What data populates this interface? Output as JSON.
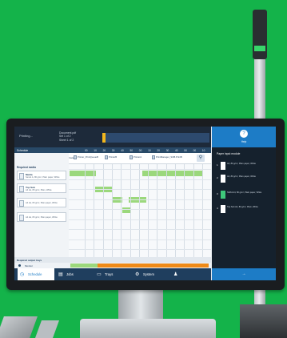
{
  "status": {
    "printer_name": "Printing...",
    "job_line1": "Document.pdf",
    "job_line2": "Set 1 of 2",
    "job_line3": "Sheet 1 of 2",
    "progress": 0.03
  },
  "header_right": {
    "label": "Help",
    "icon": "help-icon"
  },
  "schedule": {
    "title": "Schedule",
    "ticks": [
      "00",
      "10",
      "20",
      "30",
      "40",
      "50",
      "00",
      "10",
      "20",
      "30",
      "40",
      "50",
      "00",
      "10"
    ]
  },
  "left": {
    "section": "Required media",
    "media": [
      {
        "name": "Media",
        "desc": "Sens1 A, 80 g/m², Plain paper, White"
      },
      {
        "name": "Top Sub",
        "desc": "A4 LE, 80 g/m², Plain, White"
      },
      {
        "name": "",
        "desc": "A4 LE, 80 g/m², Plain paper, White"
      },
      {
        "name": "",
        "desc": "A4 LE, 80 g/m², Plain paper, White"
      }
    ]
  },
  "grid": {
    "install_label": "Install",
    "installs": [
      "Printer_PrintQueueB",
      "PrinterB",
      "PrinterA",
      "PrintManager_SOB.PrintB"
    ]
  },
  "bottom": {
    "required_trays": "Required output trays",
    "monitor": "Monitor"
  },
  "tabs": [
    {
      "label": "Schedule",
      "icon": "schedule-icon",
      "active": true
    },
    {
      "label": "Jobs",
      "icon": "document-icon",
      "active": false
    },
    {
      "label": "Trays",
      "icon": "tray-icon",
      "active": false
    },
    {
      "label": "System",
      "icon": "gear-icon",
      "active": false
    },
    {
      "label": "",
      "icon": "user-icon",
      "active": false
    }
  ],
  "right_panel": {
    "title": "Paper input module",
    "trays": [
      {
        "n": "1",
        "desc": "A4, 80 g/m², Plain paper, White",
        "color": "#ffffff"
      },
      {
        "n": "2",
        "desc": "A4, 80 g/m², Plain paper, White",
        "color": "#ffffff"
      },
      {
        "n": "3",
        "desc": "SRA3 A4, 80 g/m², Plain paper, White",
        "color": "#3ec87a"
      },
      {
        "n": "4",
        "desc": "Top Sub A4, 80 g/m², Plain, White",
        "color": "#ffffff"
      }
    ],
    "footer": "→"
  },
  "colors": {
    "green_bar": "#9bd87c",
    "orange_bar": "#ef8a17",
    "accent": "#1d7cc6",
    "background": "#14b34a"
  }
}
